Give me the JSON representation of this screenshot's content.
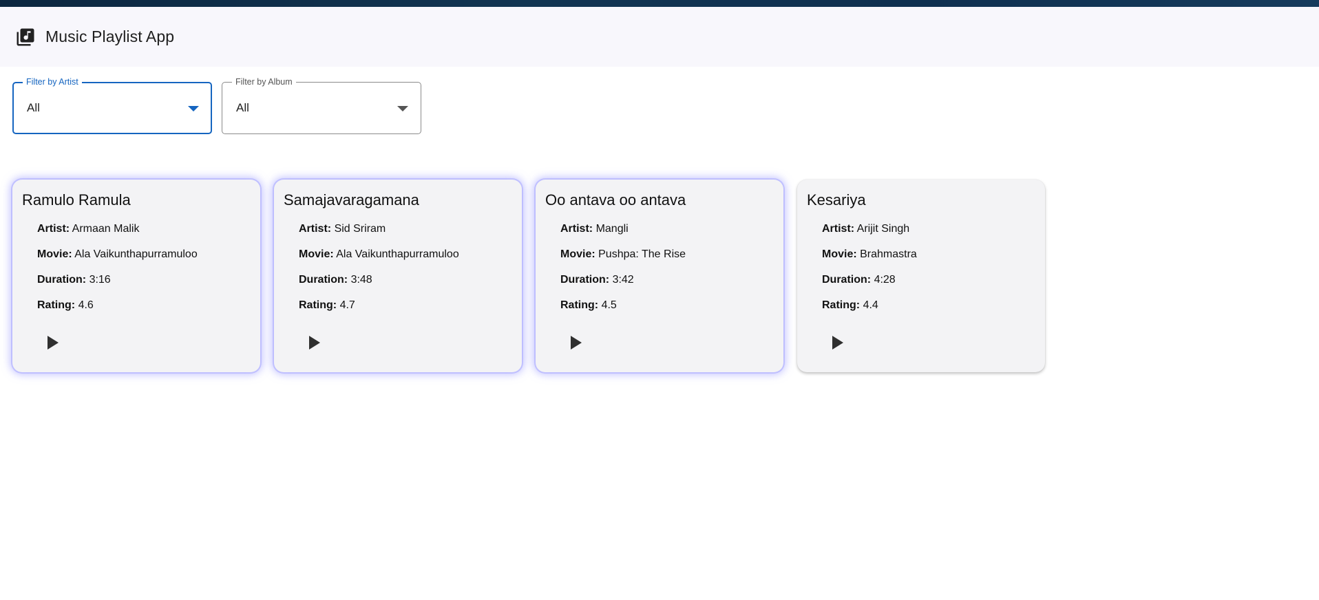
{
  "header": {
    "title": "Music Playlist App",
    "logo_icon": "library-music-icon"
  },
  "filters": {
    "artist": {
      "label": "Filter by Artist",
      "value": "All"
    },
    "album": {
      "label": "Filter by Album",
      "value": "All"
    }
  },
  "labels": {
    "artist": "Artist:",
    "movie": "Movie:",
    "duration": "Duration:",
    "rating": "Rating:"
  },
  "songs": [
    {
      "title": "Ramulo Ramula",
      "artist": "Armaan Malik",
      "movie": "Ala Vaikunthapurramuloo",
      "duration": "3:16",
      "rating": "4.6"
    },
    {
      "title": "Samajavaragamana",
      "artist": "Sid Sriram",
      "movie": "Ala Vaikunthapurramuloo",
      "duration": "3:48",
      "rating": "4.7"
    },
    {
      "title": "Oo antava oo antava",
      "artist": "Mangli",
      "movie": "Pushpa: The Rise",
      "duration": "3:42",
      "rating": "4.5"
    },
    {
      "title": "Kesariya",
      "artist": "Arijit Singh",
      "movie": "Brahmastra",
      "duration": "4:28",
      "rating": "4.4"
    }
  ],
  "colors": {
    "accent": "#1565c0",
    "card_bg": "#f3f3f5",
    "glow": "#8c8cff"
  }
}
